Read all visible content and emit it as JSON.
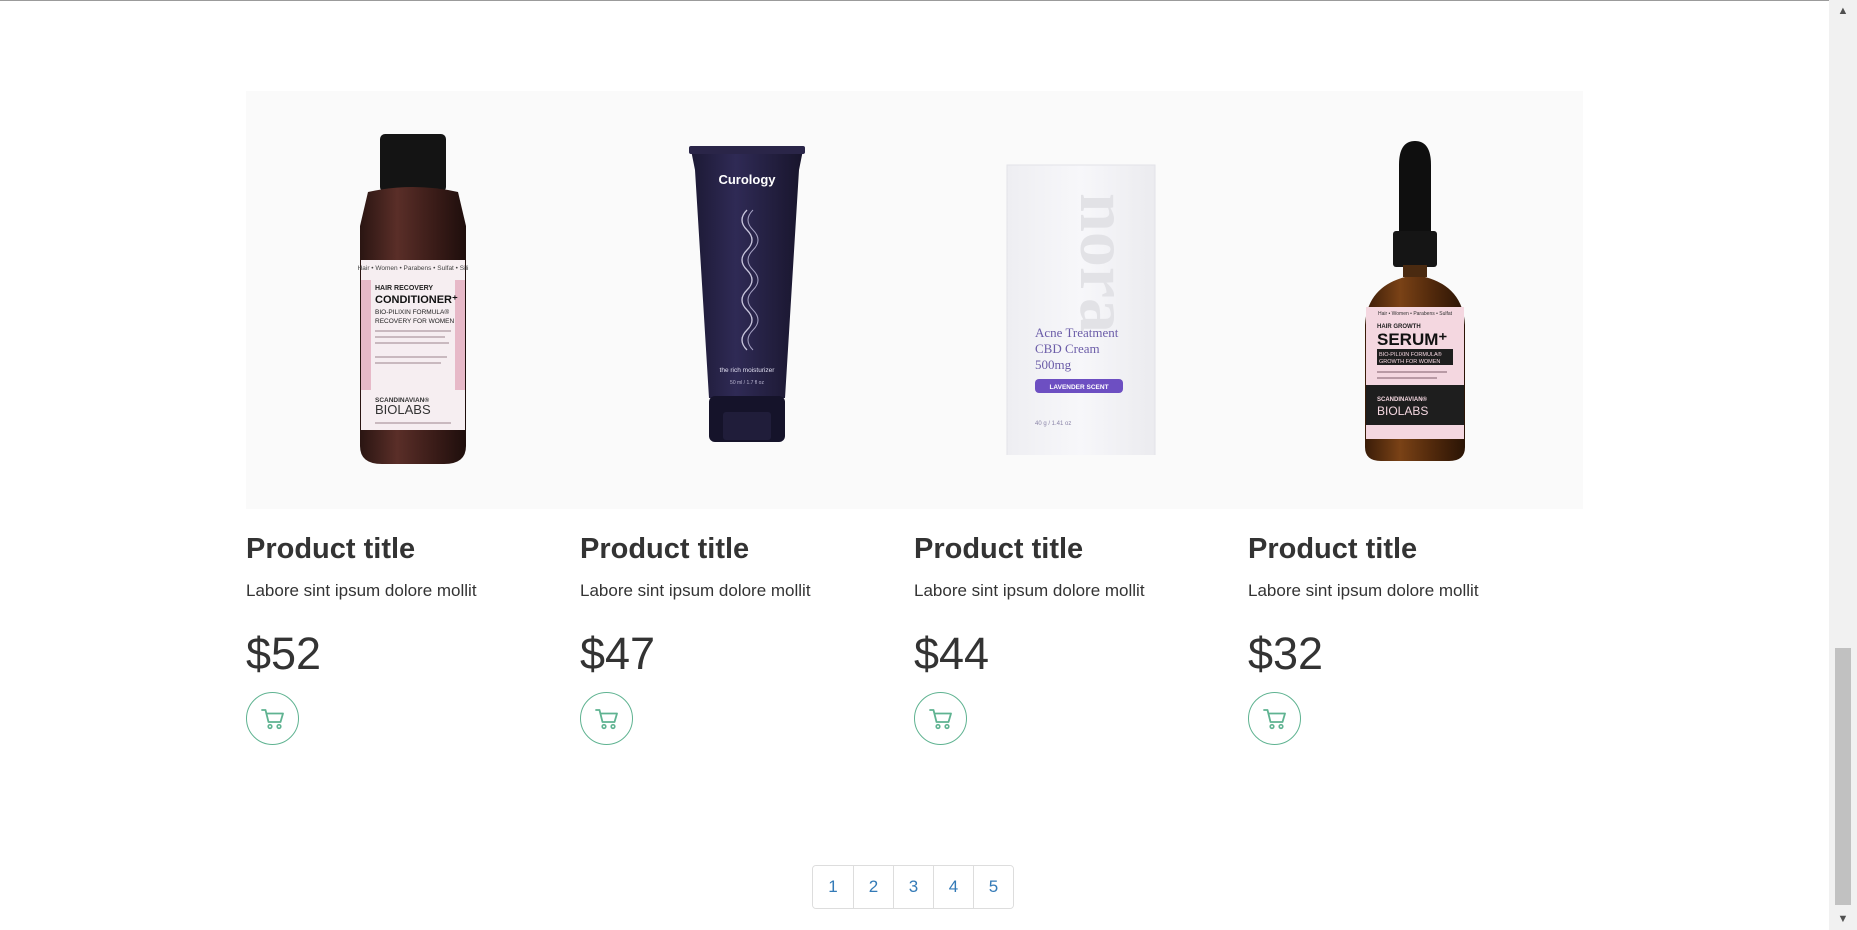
{
  "products": [
    {
      "title": "Product title",
      "description": "Labore sint ipsum dolore mollit",
      "price": "$52",
      "image_icon": "conditioner-bottle-image",
      "label": {
        "strip": "Hair • Women • Parabens • Sulfat • Sili",
        "line1": "HAIR RECOVERY",
        "line2": "CONDITIONER⁺",
        "line3": "BIO-PILIXIN FORMULA®",
        "line4": "RECOVERY FOR WOMEN",
        "brand1": "SCANDINAVIAN®",
        "brand2": "BIOLABS"
      }
    },
    {
      "title": "Product title",
      "description": "Labore sint ipsum dolore mollit",
      "price": "$47",
      "image_icon": "moisturizer-tube-image",
      "label": {
        "brand": "Curology",
        "tagline": "the rich moisturizer",
        "volume": "50 ml / 1.7 fl oz"
      }
    },
    {
      "title": "Product title",
      "description": "Labore sint ipsum dolore mollit",
      "price": "$44",
      "image_icon": "cream-box-image",
      "label": {
        "brand": "nora",
        "line1": "Acne Treatment",
        "line2": "CBD Cream",
        "line3": "500mg",
        "badge": "LAVENDER SCENT",
        "weight": "40 g / 1.41 oz"
      }
    },
    {
      "title": "Product title",
      "description": "Labore sint ipsum dolore mollit",
      "price": "$32",
      "image_icon": "serum-dropper-bottle-image",
      "label": {
        "strip": "Hair • Women • Parabens • Sulfat",
        "line1": "HAIR GROWTH",
        "line2": "SERUM⁺",
        "line3": "BIO-PILIXIN FORMULA®",
        "line4": "GROWTH FOR WOMEN",
        "brand1": "SCANDINAVIAN®",
        "brand2": "BIOLABS"
      }
    }
  ],
  "pagination": [
    "1",
    "2",
    "3",
    "4",
    "5"
  ],
  "colors": {
    "accent": "#5fb391",
    "link": "#337ab7",
    "text": "#333333",
    "image_background": "#fafafa"
  }
}
